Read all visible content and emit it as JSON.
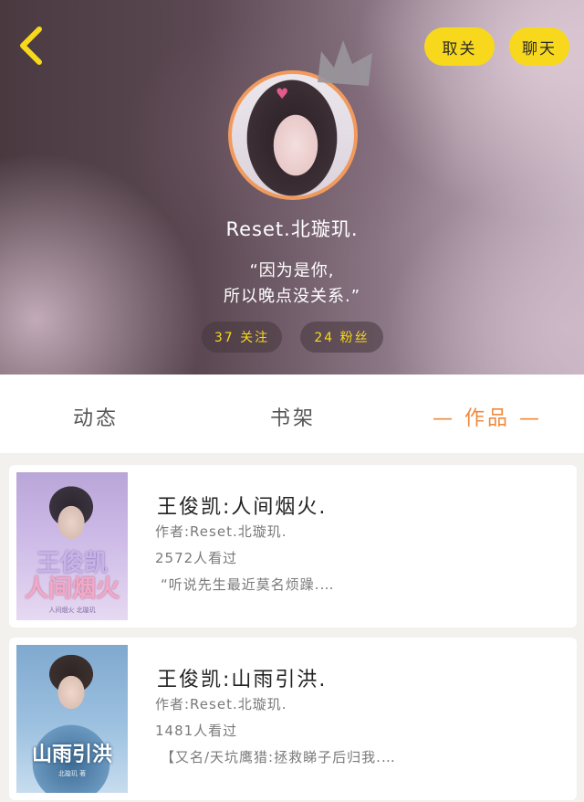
{
  "header": {
    "back_icon": "chevron-left-icon",
    "unfollow_label": "取关",
    "chat_label": "聊天",
    "username": "Reset.北璇玑.",
    "signature_line1": "“因为是你,",
    "signature_line2": "所以晚点没关系.”",
    "following_count": "37 关注",
    "fans_count": "24 粉丝",
    "accent_color": "#f8d81c",
    "avatar_border_color": "#f19a5c"
  },
  "tabs": [
    {
      "label": "动态"
    },
    {
      "label": "书架"
    },
    {
      "label": "— 作品 —",
      "active": true
    }
  ],
  "active_tab_color": "#f08a3c",
  "books": [
    {
      "title": "王俊凯:人间烟火.",
      "author": "作者:Reset.北璇玑.",
      "views": "2572人看过",
      "description": "“听说先生最近莫名烦躁.…",
      "cover_title_line1": "王俊凯",
      "cover_title_line2": "人间烟火",
      "cover_sub": "人间烟火 北璇玑"
    },
    {
      "title": "王俊凯:山雨引洪.",
      "author": "作者:Reset.北璇玑.",
      "views": "1481人看过",
      "description": "【又名/天坑鹰猎:拯救睇子后归我.…",
      "cover_title": "山雨引洪",
      "cover_sub": "北璇玑 著"
    }
  ]
}
